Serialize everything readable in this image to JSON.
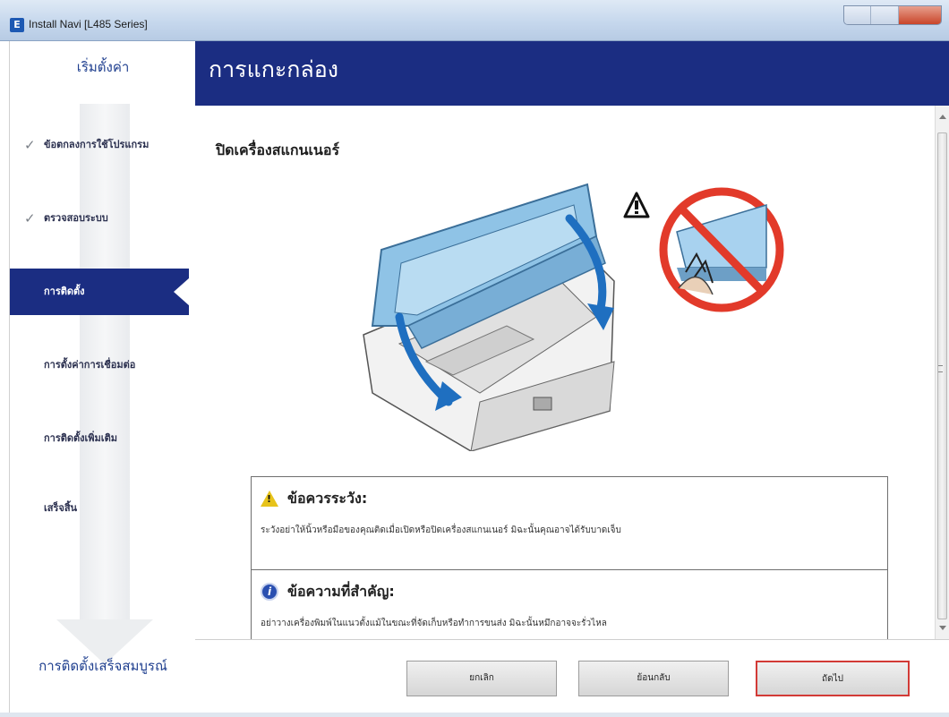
{
  "window": {
    "title": "Install Navi [L485 Series]",
    "app_icon": "epson-app-icon",
    "app_icon_letter": "E"
  },
  "sidebar": {
    "top_label": "เริ่มตั้งค่า",
    "bottom_label": "การติดตั้งเสร็จสมบูรณ์",
    "steps": [
      {
        "label": "ข้อตกลงการใช้โปรแกรม",
        "state": "done"
      },
      {
        "label": "ตรวจสอบระบบ",
        "state": "done"
      },
      {
        "label": "การติดตั้ง",
        "state": "active"
      },
      {
        "label": "การตั้งค่าการเชื่อมต่อ",
        "state": "pending"
      },
      {
        "label": "การติดตั้งเพิ่มเติม",
        "state": "pending"
      },
      {
        "label": "เสร็จสิ้น",
        "state": "pending"
      }
    ],
    "check_glyph": "✓"
  },
  "header": {
    "title": "การแกะกล่อง"
  },
  "content": {
    "section_heading": "ปิดเครื่องสแกนเนอร์",
    "caution": {
      "icon": "warning-triangle-icon",
      "icon_glyph": "!",
      "title": "ข้อควรระวัง:",
      "text": "ระวังอย่าให้นิ้วหรือมือของคุณติดเมื่อเปิดหรือปิดเครื่องสแกนเนอร์  มิฉะนั้นคุณอาจได้รับบาดเจ็บ"
    },
    "important": {
      "icon": "important-info-icon",
      "icon_glyph": "i",
      "title": "ข้อความที่สำคัญ:",
      "text": "อย่าวางเครื่องพิมพ์ในแนวตั้งแม้ในขณะที่จัดเก็บหรือทำการขนส่ง  มิฉะนั้นหมึกอาจจะรั่วไหล"
    }
  },
  "footer": {
    "cancel_label": "ยกเลิก",
    "back_label": "ย้อนกลับ",
    "next_label": "ถัดไป"
  },
  "colors": {
    "header_bg": "#1b2d82",
    "active_step_bg": "#1b2d82",
    "next_button_border": "#d23a36",
    "warning_yellow": "#e7c31a",
    "prohibit_red": "#e23a2a",
    "arrow_blue": "#1f6fc0",
    "scanner_blue": "#8fc3e6"
  }
}
